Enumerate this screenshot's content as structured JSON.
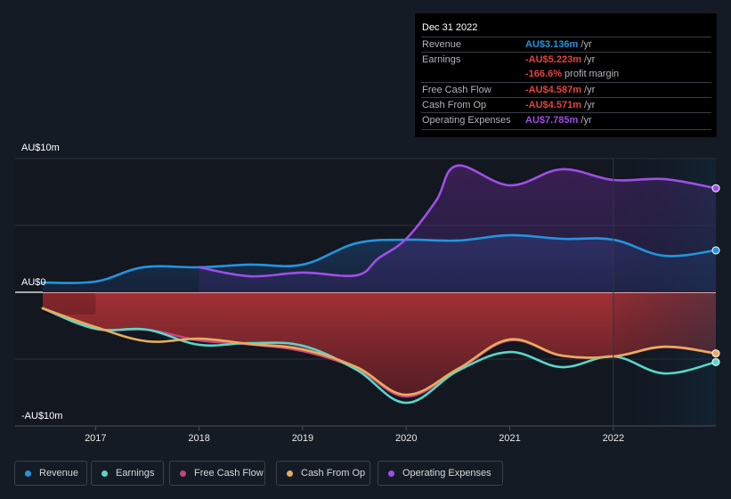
{
  "tooltip": {
    "date": "Dec 31 2022",
    "rows": [
      {
        "label": "Revenue",
        "value": "AU$3.136m",
        "unit": " /yr",
        "color": "#2394df"
      },
      {
        "label": "Earnings",
        "value": "-AU$5.223m",
        "unit": " /yr",
        "color": "#e64141"
      },
      {
        "label": "",
        "value": "-166.6%",
        "unit": " profit margin",
        "color": "#e64141"
      },
      {
        "label": "Free Cash Flow",
        "value": "-AU$4.587m",
        "unit": " /yr",
        "color": "#e64141"
      },
      {
        "label": "Cash From Op",
        "value": "-AU$4.571m",
        "unit": " /yr",
        "color": "#e64141"
      },
      {
        "label": "Operating Expenses",
        "value": "AU$7.785m",
        "unit": " /yr",
        "color": "#a04ee8"
      }
    ]
  },
  "legend": [
    {
      "label": "Revenue",
      "color": "#2394df"
    },
    {
      "label": "Earnings",
      "color": "#58d6c8"
    },
    {
      "label": "Free Cash Flow",
      "color": "#c7427f"
    },
    {
      "label": "Cash From Op",
      "color": "#e8ac5c"
    },
    {
      "label": "Operating Expenses",
      "color": "#a04ee8"
    }
  ],
  "chart_data": {
    "type": "line",
    "title": "",
    "xlabel": "",
    "ylabel": "",
    "ylim": [
      -10,
      10
    ],
    "xlim": [
      2016.49,
      2022.99
    ],
    "y_unit": "AU$ millions",
    "y_tick_labels": [
      {
        "value": 10,
        "label": "AU$10m"
      },
      {
        "value": 0,
        "label": "AU$0"
      },
      {
        "value": -10,
        "label": "-AU$10m"
      }
    ],
    "x_ticks": [
      2017,
      2018,
      2019,
      2020,
      2021,
      2022
    ],
    "x_tick_labels": [
      "2017",
      "2018",
      "2019",
      "2020",
      "2021",
      "2022"
    ],
    "forecast_shade_from": 2022.0,
    "grid": true,
    "legend_position": "bottom-left",
    "series": [
      {
        "name": "Revenue",
        "color": "#2394df",
        "area": true,
        "x": [
          2016.49,
          2017.0,
          2017.46,
          2018.0,
          2018.49,
          2019.0,
          2019.52,
          2020.0,
          2020.5,
          2021.0,
          2021.5,
          2022.0,
          2022.49,
          2022.99
        ],
        "y": [
          0.73,
          0.8,
          1.87,
          1.87,
          2.07,
          2.07,
          3.67,
          3.93,
          3.87,
          4.27,
          4.0,
          3.93,
          2.73,
          3.136
        ]
      },
      {
        "name": "Operating Expenses",
        "color": "#a04ee8",
        "area": true,
        "x": [
          2018.0,
          2018.49,
          2019.0,
          2019.52,
          2019.73,
          2020.0,
          2020.29,
          2020.49,
          2021.0,
          2021.5,
          2022.0,
          2022.49,
          2022.99
        ],
        "y": [
          1.87,
          1.2,
          1.47,
          1.27,
          2.53,
          4.0,
          6.87,
          9.47,
          8.0,
          9.2,
          8.4,
          8.47,
          7.785
        ]
      },
      {
        "name": "Free Cash Flow",
        "color": "#c7427f",
        "area": true,
        "x": [
          2016.49,
          2017.0,
          2017.5,
          2018.0,
          2018.49,
          2019.0,
          2019.52,
          2020.0,
          2020.5,
          2021.0,
          2021.5,
          2022.0,
          2022.49,
          2022.99
        ],
        "y": [
          -1.2,
          -2.73,
          -2.8,
          -3.6,
          -3.9,
          -4.4,
          -5.7,
          -7.8,
          -5.8,
          -3.6,
          -4.75,
          -4.8,
          -4.1,
          -4.587
        ]
      },
      {
        "name": "Cash From Op",
        "color": "#e8ac5c",
        "area": false,
        "x": [
          2016.49,
          2017.0,
          2017.5,
          2018.0,
          2018.49,
          2019.0,
          2019.52,
          2020.0,
          2020.5,
          2021.0,
          2021.5,
          2022.0,
          2022.49,
          2022.99
        ],
        "y": [
          -1.2,
          -2.6,
          -3.67,
          -3.47,
          -3.87,
          -4.27,
          -5.6,
          -7.67,
          -5.73,
          -3.53,
          -4.73,
          -4.8,
          -4.07,
          -4.571
        ]
      },
      {
        "name": "Earnings",
        "color": "#58d6c8",
        "area": false,
        "x": [
          2016.49,
          2017.0,
          2017.5,
          2018.0,
          2018.49,
          2019.0,
          2019.52,
          2020.0,
          2020.5,
          2021.0,
          2021.5,
          2022.0,
          2022.49,
          2022.99
        ],
        "y": [
          -1.2,
          -2.73,
          -2.8,
          -3.93,
          -3.8,
          -4.0,
          -5.8,
          -8.27,
          -5.87,
          -4.47,
          -5.6,
          -4.8,
          -6.07,
          -5.223
        ]
      }
    ]
  }
}
